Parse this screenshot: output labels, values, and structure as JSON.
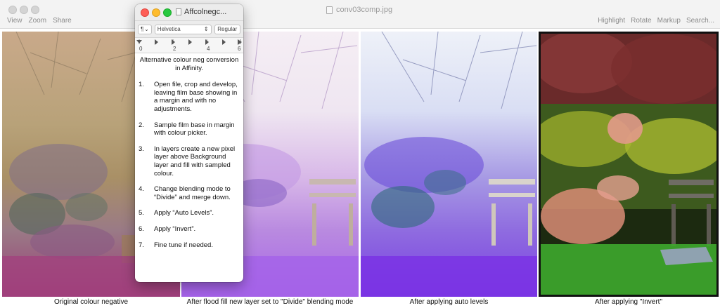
{
  "preview": {
    "title": "conv03comp.jpg",
    "toolbar_left": [
      "View",
      "Zoom",
      "Share"
    ],
    "toolbar_right": [
      "Highlight",
      "Rotate",
      "Markup",
      "Search..."
    ]
  },
  "captions": [
    "Original colour negative",
    "After flood fill new layer set to \"Divide\" blending mode",
    "After applying auto levels",
    "After applying \"Invert\""
  ],
  "textedit": {
    "title": "Affcolnegc...",
    "paragraph_style": "¶",
    "font": "Helvetica",
    "font_style": "Regular",
    "ruler_labels": [
      "0",
      "2",
      "4",
      "6"
    ],
    "heading": "Alternative colour neg conversion in Affinity.",
    "steps": [
      {
        "num": "1.",
        "text": "Open file, crop and develop, leaving film base showing in a margin and with no adjustments."
      },
      {
        "num": "2.",
        "text": "Sample film base in margin with colour picker."
      },
      {
        "num": "3.",
        "text": "In layers create a new pixel layer above Background layer and fill with sampled colour."
      },
      {
        "num": "4.",
        "text": "Change blending mode to “Divide” and merge down."
      },
      {
        "num": "5.",
        "text": "Apply “Auto Levels”."
      },
      {
        "num": "6.",
        "text": "Apply “Invert”."
      },
      {
        "num": "7.",
        "text": "Fine tune if needed."
      }
    ]
  },
  "colors": {
    "close": "#fe5f57",
    "minimize": "#febc2e",
    "maximize": "#28c840"
  }
}
